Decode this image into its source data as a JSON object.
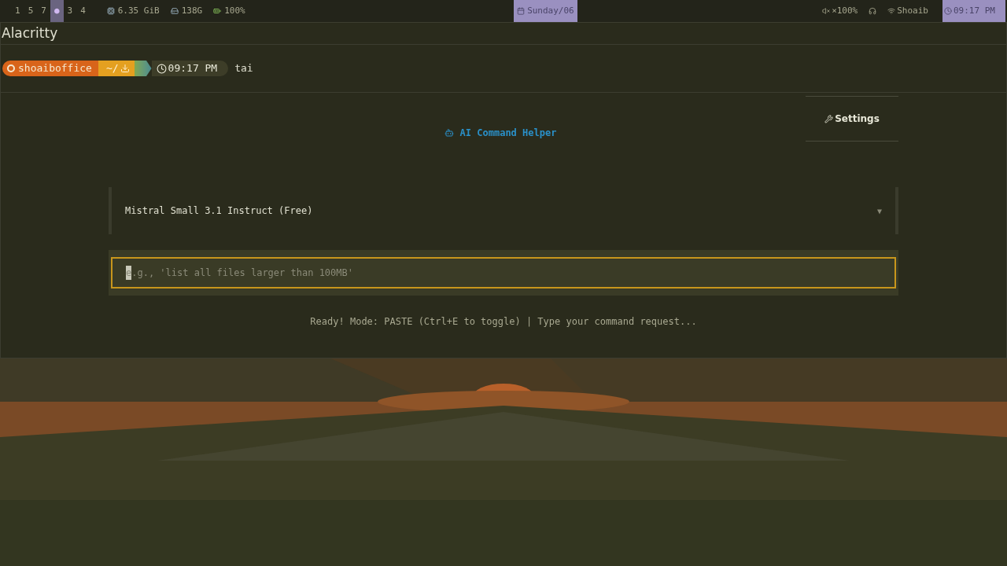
{
  "top_bar": {
    "workspaces": [
      {
        "label": "1",
        "selected": false
      },
      {
        "label": "5",
        "selected": false
      },
      {
        "label": "7",
        "selected": false
      },
      {
        "label": "●",
        "selected": true
      },
      {
        "label": "3",
        "selected": false
      },
      {
        "label": "4",
        "selected": false
      }
    ],
    "stats": [
      {
        "kind": "memory",
        "text": "6.35 GiB"
      },
      {
        "kind": "disk",
        "text": "138G"
      },
      {
        "kind": "battery",
        "text": "100%"
      }
    ],
    "date": "Sunday/06",
    "right": [
      {
        "kind": "volume",
        "text": "×100%"
      },
      {
        "kind": "headphones"
      },
      {
        "kind": "wifi",
        "text": "Shoaib"
      }
    ],
    "clock": "09:17 PM"
  },
  "window": {
    "title": "Alacritty"
  },
  "prompt": {
    "user": "shoaiboffice",
    "dir": "~/",
    "time": "09:17 PM",
    "command": "tai"
  },
  "app": {
    "title": "AI Command Helper",
    "settings": "Settings",
    "model": "Mistral Small 3.1 Instruct (Free)",
    "model_caret": "▼",
    "input": {
      "placeholder": "e.g., 'list all files larger than 100MB'",
      "focused": true
    },
    "status": "Ready! Mode: PASTE (Ctrl+E to toggle) | Type your command request..."
  }
}
